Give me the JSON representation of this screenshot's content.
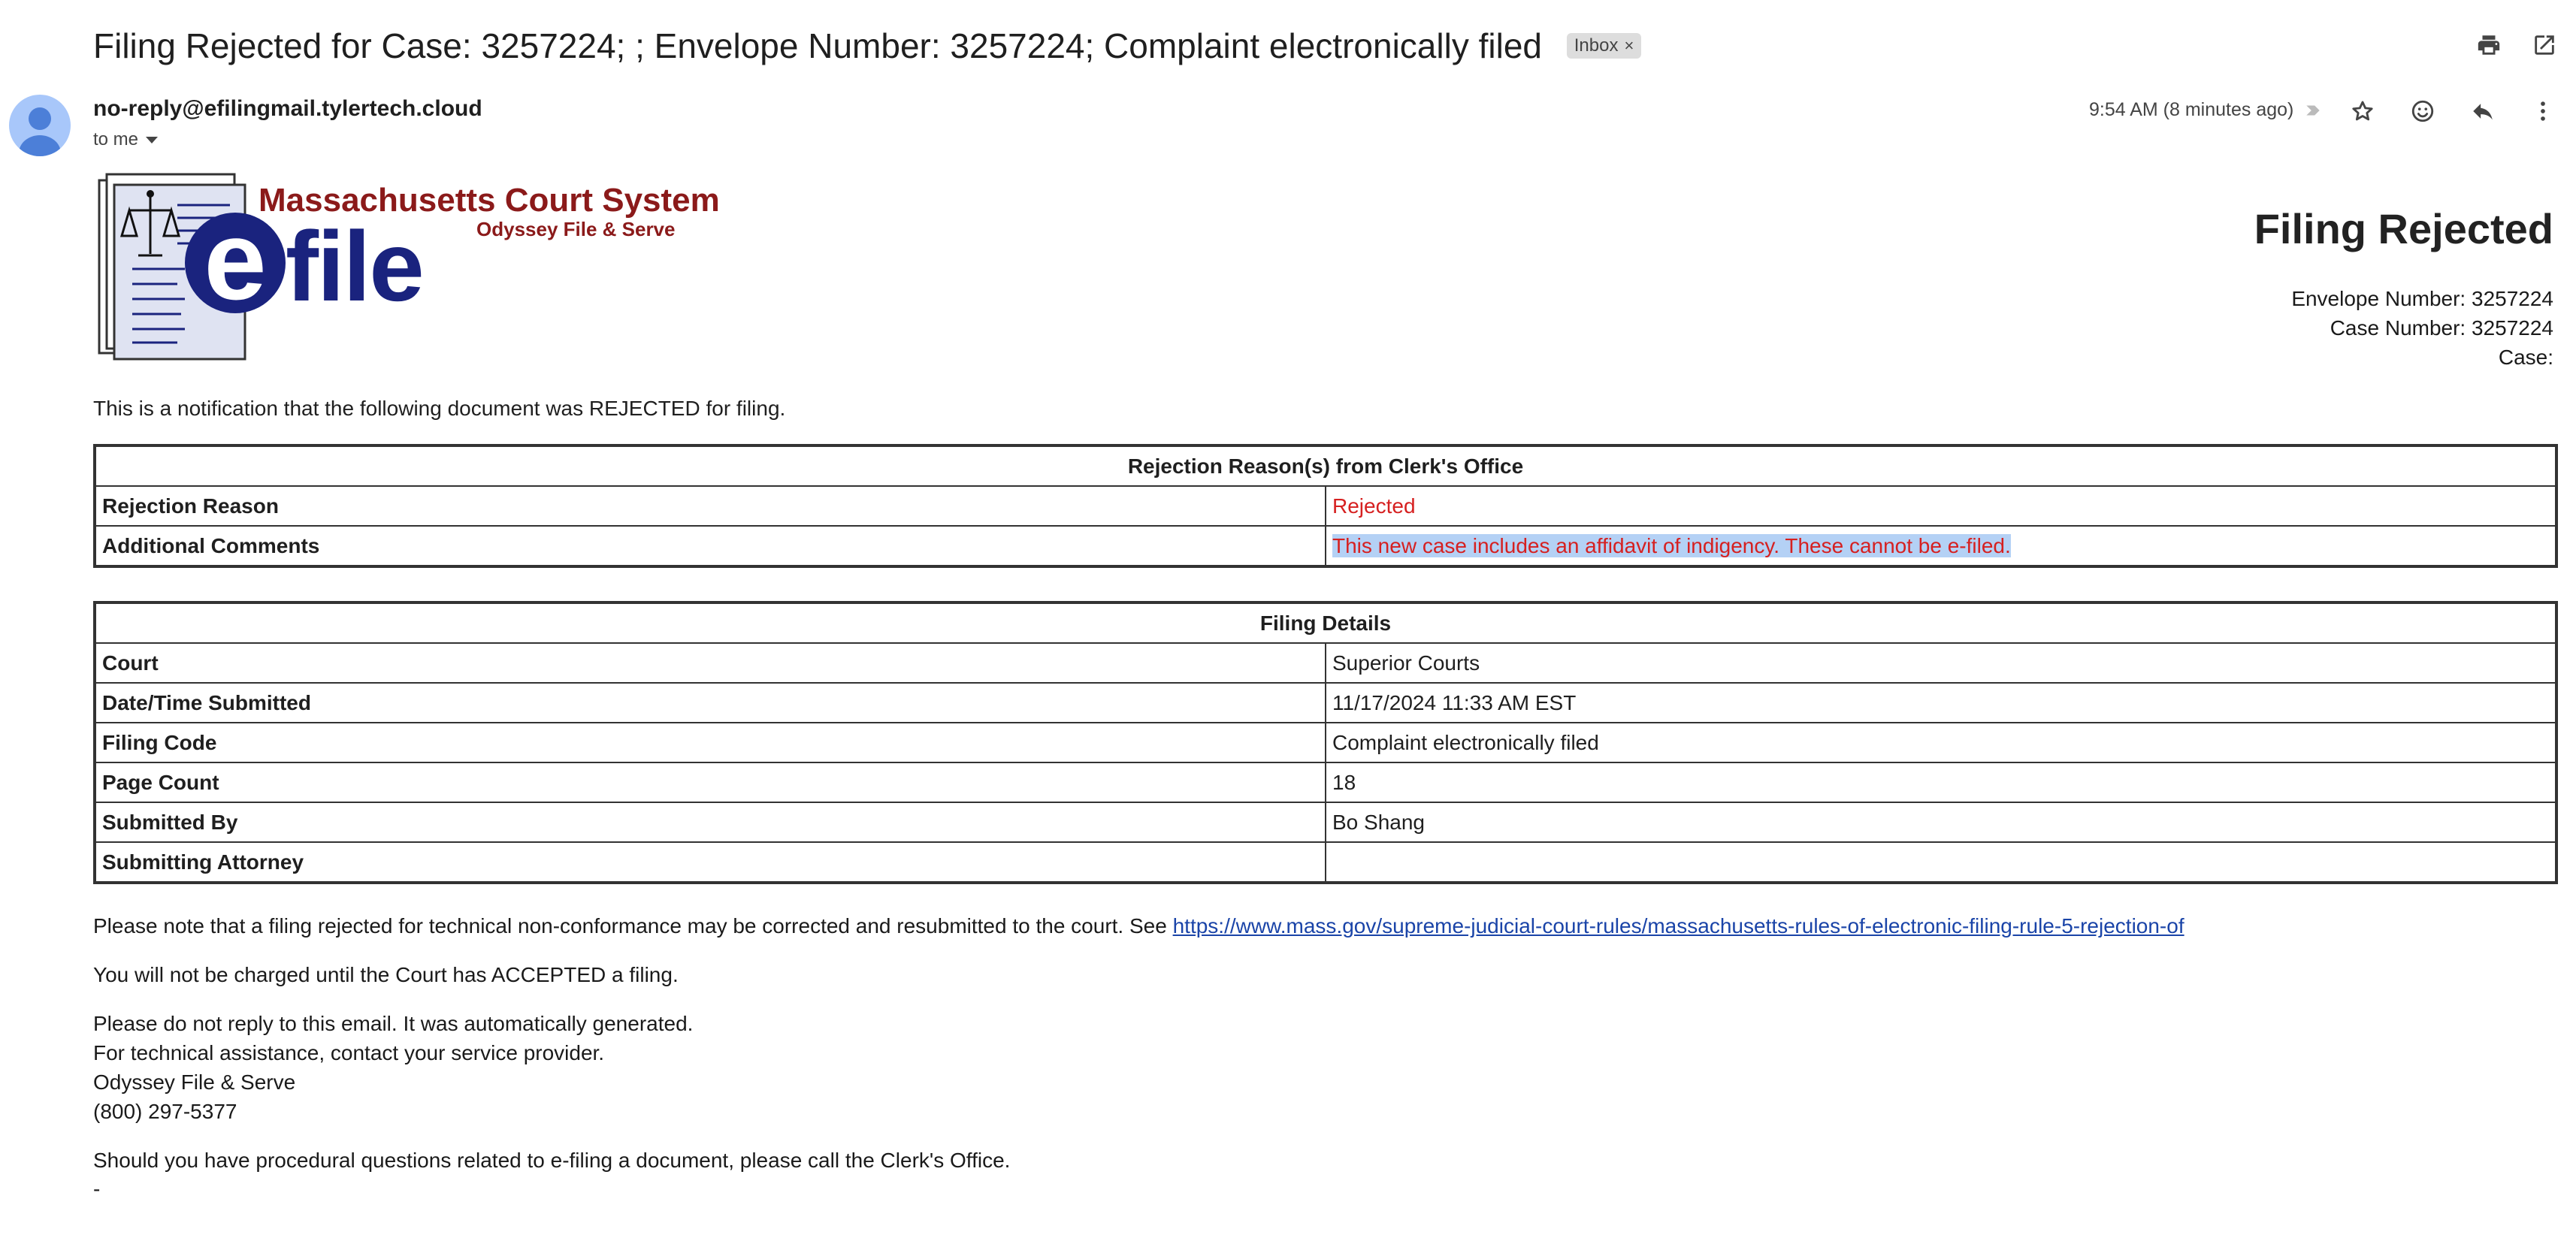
{
  "email": {
    "subject": "Filing Rejected for Case: 3257224; ; Envelope Number: 3257224; Complaint electronically filed",
    "inbox_chip": "Inbox",
    "chip_close": "×",
    "sender": "no-reply@efilingmail.tylertech.cloud",
    "recipient": "to me",
    "time": "9:54 AM (8 minutes ago)"
  },
  "icons": {
    "print": "print-icon",
    "open_new_window": "open-in-new-window-icon",
    "star": "star-icon",
    "emoji": "emoji-icon",
    "reply": "reply-icon",
    "more": "more-vert-icon"
  },
  "logo": {
    "title": "Massachusetts Court System",
    "subtitle": "Odyssey File & Serve",
    "efile_e": "e",
    "efile_rest": "file"
  },
  "body": {
    "heading": "Filing Rejected",
    "envelope_line": "Envelope Number: 3257224",
    "case_number_line": "Case Number: 3257224",
    "case_line": "Case:",
    "intro": "This is a notification that the following document was REJECTED for filing."
  },
  "rejection": {
    "header": "Rejection Reason(s) from Clerk's Office",
    "rows": [
      {
        "label": "Rejection Reason",
        "value": "Rejected"
      },
      {
        "label": "Additional Comments",
        "value": "This new case includes an affidavit of indigency. These cannot be e-filed."
      }
    ]
  },
  "details": {
    "header": "Filing Details",
    "rows": [
      {
        "label": "Court",
        "value": "Superior Courts"
      },
      {
        "label": "Date/Time Submitted",
        "value": "11/17/2024 11:33 AM EST"
      },
      {
        "label": "Filing Code",
        "value": "Complaint electronically filed"
      },
      {
        "label": "Page Count",
        "value": "18"
      },
      {
        "label": "Submitted By",
        "value": "Bo Shang"
      },
      {
        "label": "Submitting Attorney",
        "value": ""
      }
    ]
  },
  "footer": {
    "note_text": "Please note that a filing rejected for technical non-conformance may be corrected and resubmitted to the court. See ",
    "note_link": "https://www.mass.gov/supreme-judicial-court-rules/massachusetts-rules-of-electronic-filing-rule-5-rejection-of",
    "charge": "You will not be charged until the Court has ACCEPTED a filing.",
    "no_reply": "Please do not reply to this email. It was automatically generated.",
    "tech": "For technical assistance, contact your service provider.",
    "company": "Odyssey File & Serve",
    "phone": "(800) 297-5377",
    "procedural": "Should you have procedural questions related to e-filing a document, please call the Clerk's Office.",
    "dash": "-"
  },
  "colors": {
    "rejected_text": "#d62020",
    "selection_highlight": "#b4d1f5",
    "link": "#1a44a8",
    "logo_red": "#8b1a1a",
    "logo_navy": "#1a237e"
  }
}
